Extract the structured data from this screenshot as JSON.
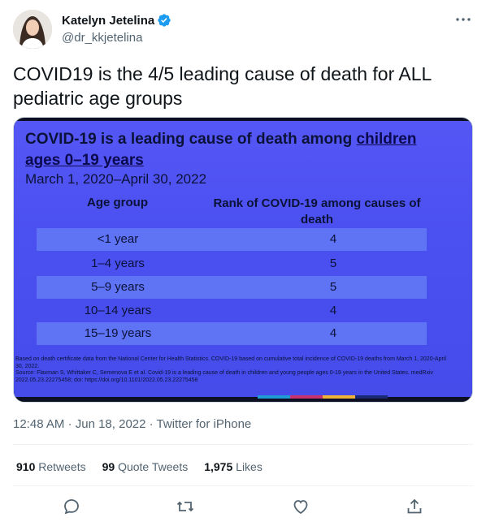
{
  "author": {
    "name": "Katelyn Jetelina",
    "handle": "@dr_kkjetelina"
  },
  "tweet": {
    "text": "COVID19 is the 4/5 leading cause of death for ALL pediatric age groups"
  },
  "image": {
    "title_plain": "COVID-19 is a leading cause of death among ",
    "title_underlined_1": "children",
    "title_underlined_2": "ages 0–19 years",
    "date_range": "March 1, 2020–April 30, 2022",
    "col_age": "Age group",
    "col_rank": "Rank of COVID-19 among causes of death",
    "rows": [
      {
        "age": "<1 year",
        "rank": "4"
      },
      {
        "age": "1–4 years",
        "rank": "5"
      },
      {
        "age": "5–9 years",
        "rank": "5"
      },
      {
        "age": "10–14 years",
        "rank": "4"
      },
      {
        "age": "15–19 years",
        "rank": "4"
      }
    ],
    "footnote_1": "Based on death certificate data from the National Center for Health Statistics. COVID-19 based on cumulative total incidence of COVID-19 deaths from March 1, 2020-April 30, 2022.",
    "footnote_2": "Source: Flaxman S, Whittaker C, Semenova E et al. Covid-19 is a leading cause of death in children and young people ages 0-19 years in the United States. medRxiv 2022.05.23.22275458; doi: https://doi.org/10.1101/2022.05.23.22275458"
  },
  "meta": {
    "time": "12:48 AM",
    "sep1": " · ",
    "date": "Jun 18, 2022",
    "sep2": " · ",
    "source": "Twitter for iPhone"
  },
  "stats": {
    "retweets_count": "910",
    "retweets_label": "Retweets",
    "quotes_count": "99",
    "quotes_label": "Quote Tweets",
    "likes_count": "1,975",
    "likes_label": "Likes"
  },
  "icons": [
    "verified-badge-icon",
    "more-icon",
    "reply-icon",
    "retweet-icon",
    "like-icon",
    "share-icon"
  ],
  "colors": {
    "slide_bg": "#4b50f0",
    "verified": "#1d9bf0",
    "muted": "#536471"
  }
}
